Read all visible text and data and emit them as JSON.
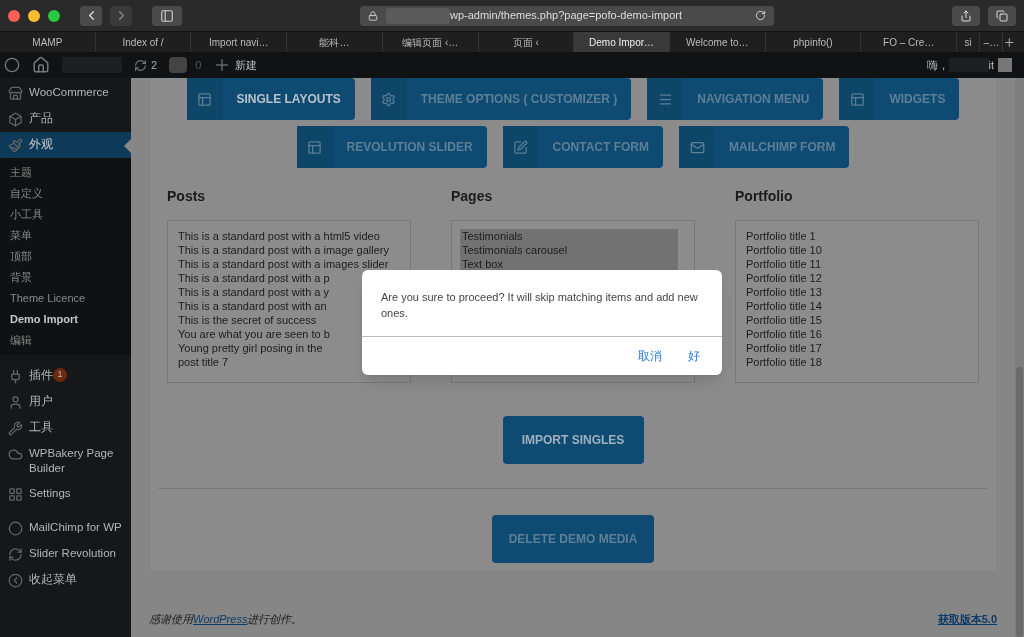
{
  "browser": {
    "url": "wp-admin/themes.php?page=pofo-demo-import",
    "tabs": [
      {
        "label": "MAMP",
        "selected": false
      },
      {
        "label": "Index of /",
        "selected": false
      },
      {
        "label": "Import navi…",
        "selected": false
      },
      {
        "label": "能科…",
        "selected": false
      },
      {
        "label": "编辑页面 ‹…",
        "selected": false
      },
      {
        "label": "页面 ‹",
        "selected": false
      },
      {
        "label": "Demo Impor…",
        "selected": true
      },
      {
        "label": "Welcome to…",
        "selected": false
      },
      {
        "label": "phpinfo()",
        "selected": false
      },
      {
        "label": "FO – Cre…",
        "selected": false
      },
      {
        "label": "si",
        "selected": false
      },
      {
        "label": "–…",
        "selected": false
      }
    ]
  },
  "admin_bar": {
    "updates": "2",
    "comments": "0",
    "new": "新建",
    "greeting": "嗨，",
    "user_suffix": "it"
  },
  "sidebar": {
    "items": [
      {
        "label": "WooCommerce",
        "selected": false
      },
      {
        "label": "产品",
        "selected": false
      },
      {
        "label": "外观",
        "selected": true,
        "children": [
          {
            "label": "主题",
            "selected": false
          },
          {
            "label": "自定义",
            "selected": false
          },
          {
            "label": "小工具",
            "selected": false
          },
          {
            "label": "菜单",
            "selected": false
          },
          {
            "label": "顶部",
            "selected": false
          },
          {
            "label": "背景",
            "selected": false
          },
          {
            "label": "Theme Licence",
            "selected": false
          },
          {
            "label": "Demo Import",
            "selected": true
          },
          {
            "label": "编辑",
            "selected": false
          }
        ]
      },
      {
        "label": "插件",
        "selected": false,
        "badge": "1"
      },
      {
        "label": "用户",
        "selected": false
      },
      {
        "label": "工具",
        "selected": false
      },
      {
        "label": "WPBakery Page Builder",
        "selected": false
      },
      {
        "label": "Settings",
        "selected": false
      },
      {
        "label": "MailChimp for WP",
        "selected": false
      },
      {
        "label": "Slider Revolution",
        "selected": false
      },
      {
        "label": "收起菜单",
        "selected": false
      }
    ]
  },
  "import_tabs": [
    [
      {
        "label": "SINGLE LAYOUTS",
        "selected": true
      },
      {
        "label": "THEME OPTIONS ( CUSTOMIZER )",
        "selected": false
      },
      {
        "label": "NAVIGATION MENU",
        "selected": false
      },
      {
        "label": "WIDGETS",
        "selected": false
      }
    ],
    [
      {
        "label": "REVOLUTION SLIDER",
        "selected": false
      },
      {
        "label": "CONTACT FORM",
        "selected": false
      },
      {
        "label": "MAILCHIMP FORM",
        "selected": false
      }
    ]
  ],
  "lists": [
    {
      "title": "Posts",
      "items": [
        {
          "label": "This is a standard post with a html5 video",
          "selected": false
        },
        {
          "label": "This is a standard post with a image gallery",
          "selected": false
        },
        {
          "label": "This is a standard post with a images slider",
          "selected": false
        },
        {
          "label": "This is a standard post with a p",
          "selected": false
        },
        {
          "label": "This is a standard post with a y",
          "selected": false
        },
        {
          "label": "This is a standard post with an",
          "selected": false
        },
        {
          "label": "This is the secret of success",
          "selected": false
        },
        {
          "label": "You are what you are seen to b",
          "selected": false
        },
        {
          "label": "Young pretty girl posing in the",
          "selected": false
        },
        {
          "label": "post title 7",
          "selected": false
        }
      ]
    },
    {
      "title": "Pages",
      "items": [
        {
          "label": "Testimonials",
          "selected": true
        },
        {
          "label": "Testimonials carousel",
          "selected": true
        },
        {
          "label": "Text box",
          "selected": true
        }
      ]
    },
    {
      "title": "Portfolio",
      "items": [
        {
          "label": "Portfolio title 1",
          "selected": false
        },
        {
          "label": "Portfolio title 10",
          "selected": false
        },
        {
          "label": "Portfolio title 11",
          "selected": false
        },
        {
          "label": "Portfolio title 12",
          "selected": false
        },
        {
          "label": "Portfolio title 13",
          "selected": false
        },
        {
          "label": "Portfolio title 14",
          "selected": false
        },
        {
          "label": "Portfolio title 15",
          "selected": false
        },
        {
          "label": "Portfolio title 16",
          "selected": false
        },
        {
          "label": "Portfolio title 17",
          "selected": false
        },
        {
          "label": "Portfolio title 18",
          "selected": false
        }
      ]
    }
  ],
  "import_button": "IMPORT SINGLES",
  "delete_button": "DELETE DEMO MEDIA",
  "dialog": {
    "message": "Are you sure to proceed? It will skip matching items and add new ones.",
    "cancel": "取消",
    "ok": "好"
  },
  "footer": {
    "before": "感谢使用",
    "link": "WordPress",
    "after": "进行创作。",
    "version": "获取版本5.0"
  }
}
